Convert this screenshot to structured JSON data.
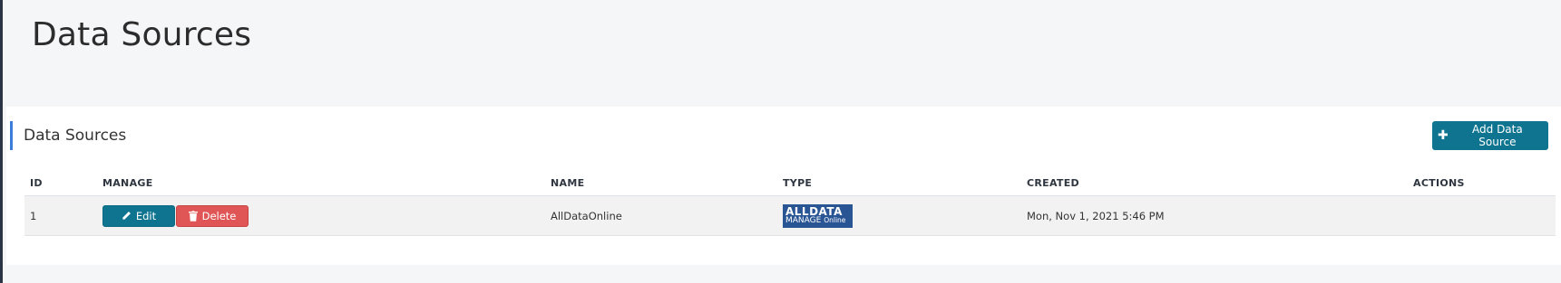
{
  "page": {
    "title": "Data Sources"
  },
  "panel": {
    "header": "Data Sources",
    "add_button_label": "Add Data Source"
  },
  "table": {
    "columns": [
      "ID",
      "MANAGE",
      "NAME",
      "TYPE",
      "CREATED",
      "ACTIONS"
    ],
    "rows": [
      {
        "id": "1",
        "edit_label": "Edit",
        "delete_label": "Delete",
        "name": "AllDataOnline",
        "type_logo": {
          "top": "ALLDATA",
          "bottom_main": "MANAGE",
          "bottom_small": "Online"
        },
        "created": "Mon, Nov 1, 2021 5:46 PM",
        "actions": ""
      }
    ]
  },
  "colors": {
    "primary": "#0e7490",
    "danger": "#e05555",
    "accent": "#3b7dd8",
    "logo_bg": "#2a5595"
  },
  "icons": {
    "add": "plus-icon",
    "edit": "pencil-icon",
    "delete": "trash-icon"
  }
}
